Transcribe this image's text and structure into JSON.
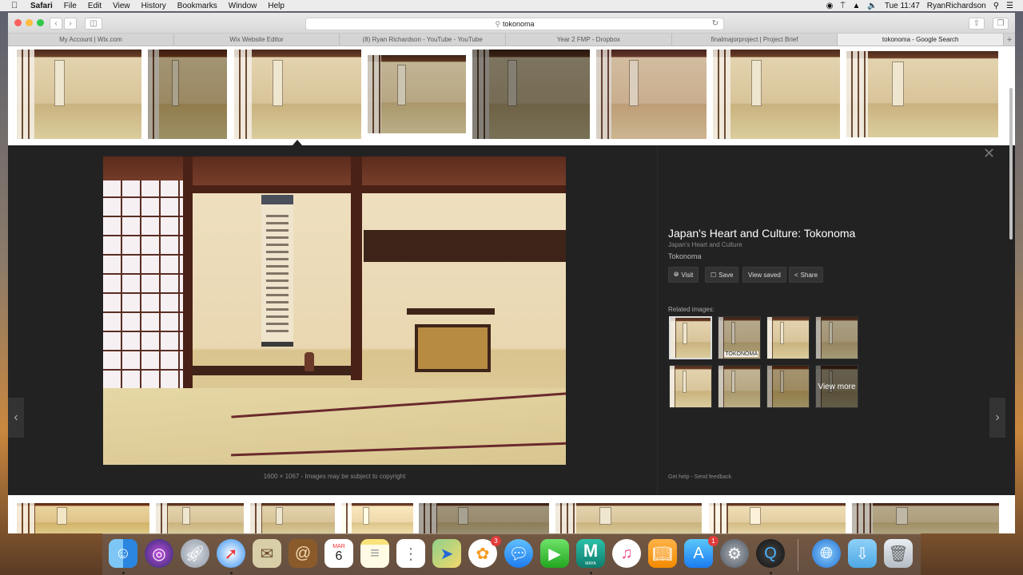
{
  "menubar": {
    "app": "Safari",
    "items": [
      "File",
      "Edit",
      "View",
      "History",
      "Bookmarks",
      "Window",
      "Help"
    ],
    "clock": "Tue 11:47",
    "user": "RyanRichardson"
  },
  "browser": {
    "address": "tokonoma",
    "tabs": [
      {
        "label": "My Account | Wix.com"
      },
      {
        "label": "Wix Website Editor"
      },
      {
        "label": "(8) Ryan Richardson - YouTube - YouTube"
      },
      {
        "label": "Year 2 FMP - Dropbox"
      },
      {
        "label": "finalmajorproject | Project Brief"
      },
      {
        "label": "tokonoma - Google Search"
      }
    ]
  },
  "preview": {
    "title": "Japan's Heart and Culture: Tokonoma",
    "subtitle": "Japan's Heart and Culture",
    "source": "Tokonoma",
    "actions": {
      "visit": "Visit",
      "save": "Save",
      "view_saved": "View saved",
      "share": "Share"
    },
    "related_label": "Related images:",
    "related_overlay": "TOKONOMA",
    "view_more": "View more",
    "dimensions_caption": "1600 × 1067  -  Images may be subject to copyright",
    "footer": "Get help  -  Send feedback"
  },
  "dock": {
    "calendar_month": "MAR",
    "calendar_day": "6",
    "facetime_badge": "3",
    "appstore_badge": "1",
    "maya_label": "MAYA"
  }
}
